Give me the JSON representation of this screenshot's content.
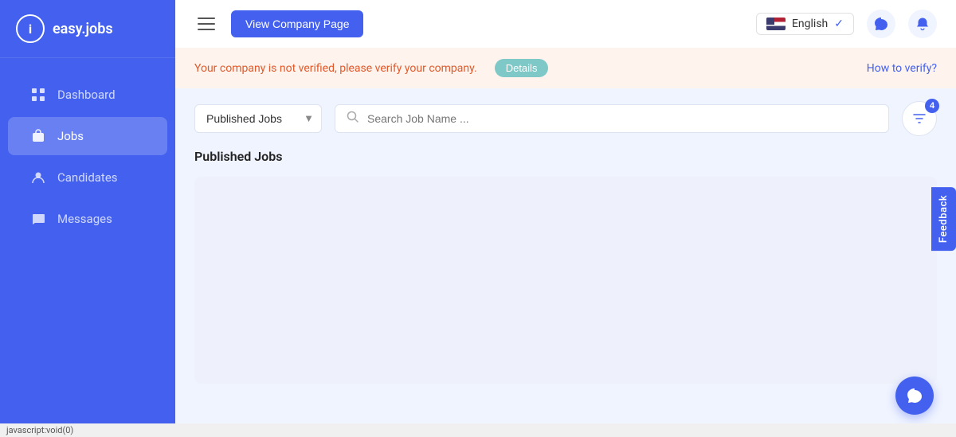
{
  "app": {
    "logo_text": "easy.jobs",
    "logo_icon": "i"
  },
  "sidebar": {
    "items": [
      {
        "id": "dashboard",
        "label": "Dashboard",
        "icon": "⊞",
        "active": false
      },
      {
        "id": "jobs",
        "label": "Jobs",
        "icon": "💼",
        "active": true
      },
      {
        "id": "candidates",
        "label": "Candidates",
        "icon": "👤",
        "active": false
      },
      {
        "id": "messages",
        "label": "Messages",
        "icon": "💬",
        "active": false
      }
    ]
  },
  "header": {
    "view_company_btn": "View Company Page",
    "language": "English",
    "language_check": "✓"
  },
  "banner": {
    "message": "Your company is not verified, please verify your company.",
    "details_btn": "Details",
    "how_to_verify": "How to verify?"
  },
  "filter": {
    "select_label": "Published Jobs",
    "search_placeholder": "Search Job Name ...",
    "filter_count": "4"
  },
  "jobs_section": {
    "title": "Published Jobs"
  },
  "feedback": {
    "label": "Feedback"
  },
  "statusbar": {
    "text": "javascript:void(0)"
  }
}
